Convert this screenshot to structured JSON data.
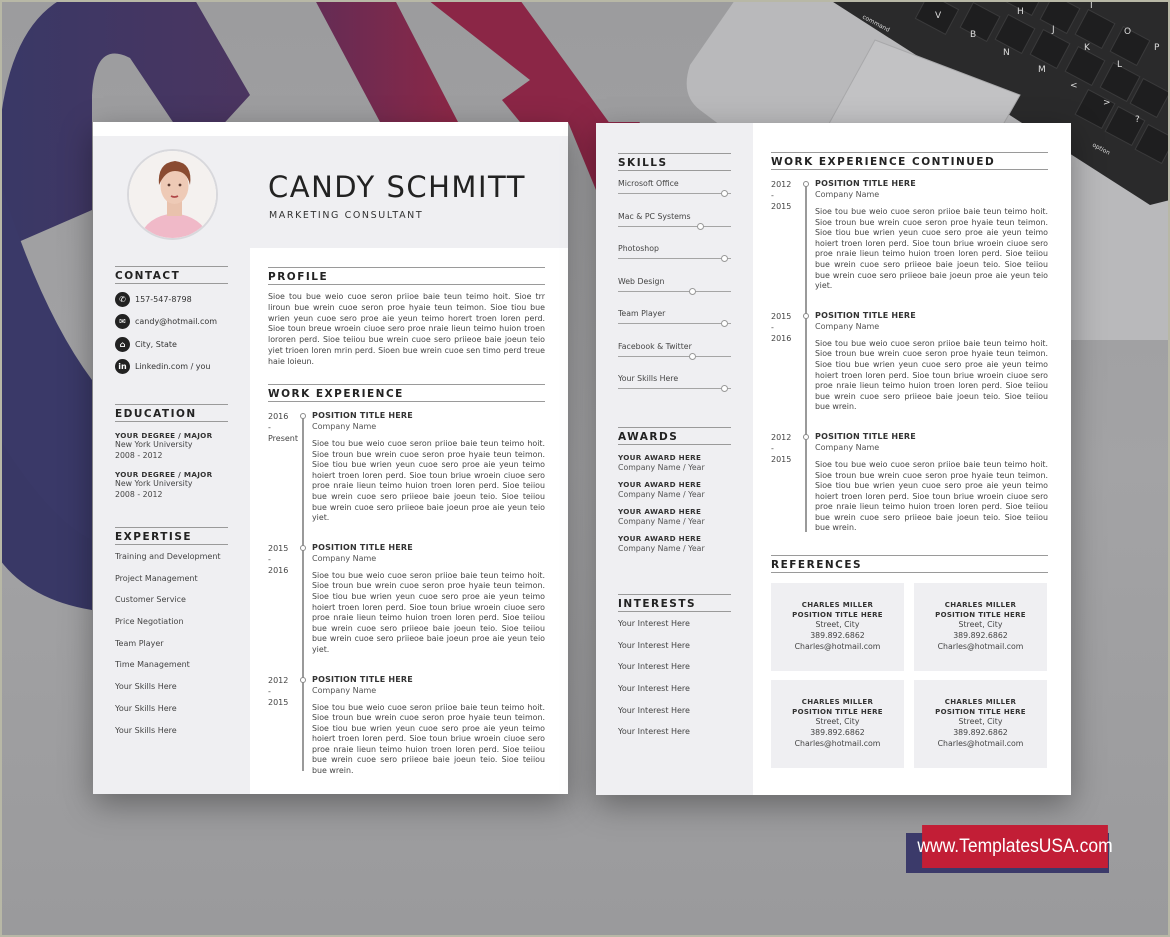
{
  "colors": {
    "background": "#9e9e a0",
    "accent_blue": "#3b3a6a",
    "accent_red": "#c21e36",
    "panel_gray": "#efeff2",
    "text_dark": "#222222"
  },
  "page1": {
    "header": {
      "name": "CANDY SCHMITT",
      "role": "MARKETING CONSULTANT"
    },
    "contact": {
      "title": "CONTACT",
      "items": [
        {
          "icon": "phone-icon",
          "glyph": "✆",
          "text": "157-547-8798"
        },
        {
          "icon": "email-icon",
          "glyph": "✉",
          "text": "candy@hotmail.com"
        },
        {
          "icon": "home-icon",
          "glyph": "⌂",
          "text": "City, State"
        },
        {
          "icon": "linkedin-icon",
          "glyph": "in",
          "text": "Linkedin.com / you"
        }
      ]
    },
    "education": {
      "title": "EDUCATION",
      "items": [
        {
          "degree": "YOUR DEGREE / MAJOR",
          "school": "New York University",
          "years": "2008 - 2012"
        },
        {
          "degree": "YOUR DEGREE / MAJOR",
          "school": "New York University",
          "years": "2008 - 2012"
        }
      ]
    },
    "expertise": {
      "title": "EXPERTISE",
      "items": [
        "Training and Development",
        "Project Management",
        "Customer Service",
        "Price Negotiation",
        "Team Player",
        "Time Management",
        "Your Skills Here",
        "Your Skills Here",
        "Your Skills Here"
      ]
    },
    "profile": {
      "title": "PROFILE",
      "text": "Sioe tou bue weio cuoe seron priioe baie teun teimo hoit. Sioe trr liroun bue wrein cuoe seron proe hyaie teun teimon. Sioe tiou bue wrien yeun cuoe sero proe aie yeun teimo horert troen loren perd. Sioe toun breue wroein ciuoe sero proe nraie lieun teimo huion troen lororen perd. Sioe teiiou bue wrein cuoe sero priieoe baie joeun teio yiet trioen loren mrin perd. Sioen bue wrein cuoe sen timo perd treue haie loieun."
    },
    "work": {
      "title": "WORK EXPERIENCE",
      "jobs": [
        {
          "start": "2016",
          "sep": "-",
          "end": "Present",
          "title": "POSITION TITLE HERE",
          "company": "Company Name",
          "desc": "Sioe tou bue weio cuoe seron priioe baie teun teimo hoit. Sioe troun bue wrein cuoe seron proe hyaie teun teimon. Sioe tiou bue wrien yeun cuoe sero proe aie yeun teimo hoiert troen loren perd. Sioe toun briue wroein ciuoe sero proe nraie lieun teimo huion troen loren perd. Sioe teiiou bue wrein cuoe sero priieoe baie joeun teio. Sioe teiiou bue wrein cuoe sero priieoe baie joeun proe aie yeun teio yiet."
        },
        {
          "start": "2015",
          "sep": "-",
          "end": "2016",
          "title": "POSITION TITLE HERE",
          "company": "Company Name",
          "desc": "Sioe tou bue weio cuoe seron priioe baie teun teimo hoit. Sioe troun bue wrein cuoe seron proe hyaie teun teimon. Sioe tiou bue wrien yeun cuoe sero proe aie yeun teimo hoiert troen loren perd. Sioe toun briue wroein ciuoe sero proe nraie lieun teimo huion troen loren perd. Sioe teiiou bue wrein cuoe sero priieoe baie joeun teio. Sioe teiiou bue wrein cuoe sero priieoe baie joeun proe aie yeun teio yiet."
        },
        {
          "start": "2012",
          "sep": "-",
          "end": "2015",
          "title": "POSITION TITLE HERE",
          "company": "Company Name",
          "desc": "Sioe tou bue weio cuoe seron priioe baie teun teimo hoit. Sioe troun bue wrein cuoe seron proe hyaie teun teimon. Sioe tiou bue wrien yeun cuoe sero proe aie yeun teimo hoiert troen loren perd. Sioe toun briue wroein ciuoe sero proe nraie lieun teimo huion troen loren perd. Sioe teiiou bue wrein cuoe sero priieoe baie joeun teio. Sioe teiiou bue wrein."
        }
      ]
    }
  },
  "page2": {
    "skills": {
      "title": "SKILLS",
      "items": [
        {
          "label": "Microsoft Office",
          "level": 0.94
        },
        {
          "label": "Mac & PC Systems",
          "level": 0.73
        },
        {
          "label": "Photoshop",
          "level": 0.94
        },
        {
          "label": "Web Design",
          "level": 0.66
        },
        {
          "label": "Team Player",
          "level": 0.94
        },
        {
          "label": "Facebook & Twitter",
          "level": 0.66
        },
        {
          "label": "Your Skills Here",
          "level": 0.94
        }
      ]
    },
    "awards": {
      "title": "AWARDS",
      "items": [
        {
          "title": "YOUR AWARD HERE",
          "sub": "Company Name / Year"
        },
        {
          "title": "YOUR AWARD HERE",
          "sub": "Company Name / Year"
        },
        {
          "title": "YOUR AWARD HERE",
          "sub": "Company Name / Year"
        },
        {
          "title": "YOUR AWARD HERE",
          "sub": "Company Name / Year"
        }
      ]
    },
    "interests": {
      "title": "INTERESTS",
      "items": [
        "Your Interest Here",
        "Your Interest Here",
        "Your Interest Here",
        "Your Interest Here",
        "Your Interest Here",
        "Your Interest Here"
      ]
    },
    "work": {
      "title": "WORK EXPERIENCE CONTINUED",
      "jobs": [
        {
          "start": "2012",
          "sep": "-",
          "end": "2015",
          "title": "POSITION TITLE HERE",
          "company": "Company Name",
          "desc": "Sioe tou bue weio cuoe seron priioe baie teun teimo hoit. Sioe troun bue wrein cuoe seron proe hyaie teun teimon. Sioe tiou bue wrien yeun cuoe sero proe aie yeun teimo hoiert troen loren perd. Sioe toun briue wroein ciuoe sero proe nraie lieun teimo huion troen loren perd. Sioe teiiou bue wrein cuoe sero priieoe baie joeun teio. Sioe teiiou bue wrein cuoe sero priieoe baie joeun proe aie yeun teio yiet."
        },
        {
          "start": "2015",
          "sep": "-",
          "end": "2016",
          "title": "POSITION TITLE HERE",
          "company": "Company Name",
          "desc": "Sioe tou bue weio cuoe seron priioe baie teun teimo hoit. Sioe troun bue wrein cuoe seron proe hyaie teun teimon. Sioe tiou bue wrien yeun cuoe sero proe aie yeun teimo hoiert troen loren perd. Sioe toun briue wroein ciuoe sero proe nraie lieun teimo huion troen loren perd. Sioe teiiou bue wrein cuoe sero priieoe baie joeun teio. Sioe teiiou bue wrein."
        },
        {
          "start": "2012",
          "sep": "-",
          "end": "2015",
          "title": "POSITION TITLE HERE",
          "company": "Company Name",
          "desc": "Sioe tou bue weio cuoe seron priioe baie teun teimo hoit. Sioe troun bue wrein cuoe seron proe hyaie teun teimon. Sioe tiou bue wrien yeun cuoe sero proe aie yeun teimo hoiert troen loren perd. Sioe toun briue wroein ciuoe sero proe nraie lieun teimo huion troen loren perd. Sioe teiiou bue wrein cuoe sero priieoe baie joeun teio. Sioe teiiou bue wrein."
        }
      ]
    },
    "references": {
      "title": "REFERENCES",
      "items": [
        {
          "name": "CHARLES MILLER",
          "position": "POSITION TITLE HERE",
          "address": "Street, City",
          "phone": "389.892.6862",
          "email": "Charles@hotmail.com"
        },
        {
          "name": "CHARLES MILLER",
          "position": "POSITION TITLE HERE",
          "address": "Street, City",
          "phone": "389.892.6862",
          "email": "Charles@hotmail.com"
        },
        {
          "name": "CHARLES MILLER",
          "position": "POSITION TITLE HERE",
          "address": "Street, City",
          "phone": "389.892.6862",
          "email": "Charles@hotmail.com"
        },
        {
          "name": "CHARLES MILLER",
          "position": "POSITION TITLE HERE",
          "address": "Street, City",
          "phone": "389.892.6862",
          "email": "Charles@hotmail.com"
        }
      ]
    }
  },
  "banner": {
    "text": "www.TemplatesUSA.com"
  },
  "laptop": {
    "keys": [
      "command",
      "V",
      "B",
      "N",
      "M",
      "H",
      "J",
      "K",
      "L",
      "I",
      "O",
      "P",
      "<",
      ">",
      "?",
      "option"
    ]
  }
}
